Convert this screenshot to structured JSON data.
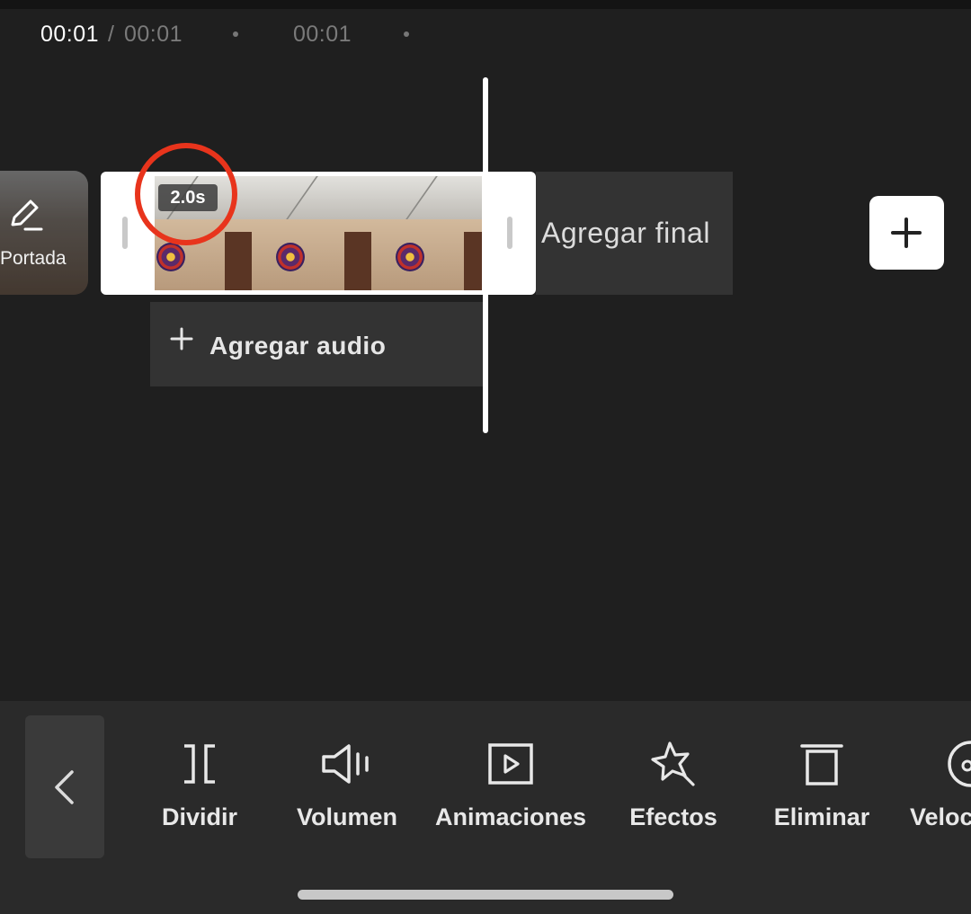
{
  "timecode": {
    "current": "00:01",
    "separator": "/",
    "total": "00:01",
    "ruler_label": "00:01"
  },
  "timeline": {
    "cover_label": "Portada",
    "clip_duration": "2.0s",
    "add_ending_label": "Agregar final",
    "add_audio_label": "Agregar audio"
  },
  "toolbar": {
    "items": [
      {
        "label": "Dividir",
        "icon": "split-icon"
      },
      {
        "label": "Volumen",
        "icon": "volume-icon"
      },
      {
        "label": "Animaciones",
        "icon": "animation-play-icon"
      },
      {
        "label": "Efectos",
        "icon": "effects-star-icon"
      },
      {
        "label": "Eliminar",
        "icon": "trash-icon"
      },
      {
        "label": "Veloc",
        "icon": "speed-icon"
      }
    ]
  },
  "colors": {
    "background": "#1f1f1f",
    "panel": "#333333",
    "toolbar": "#2a2a2a",
    "highlight_circle": "#e8341c"
  }
}
